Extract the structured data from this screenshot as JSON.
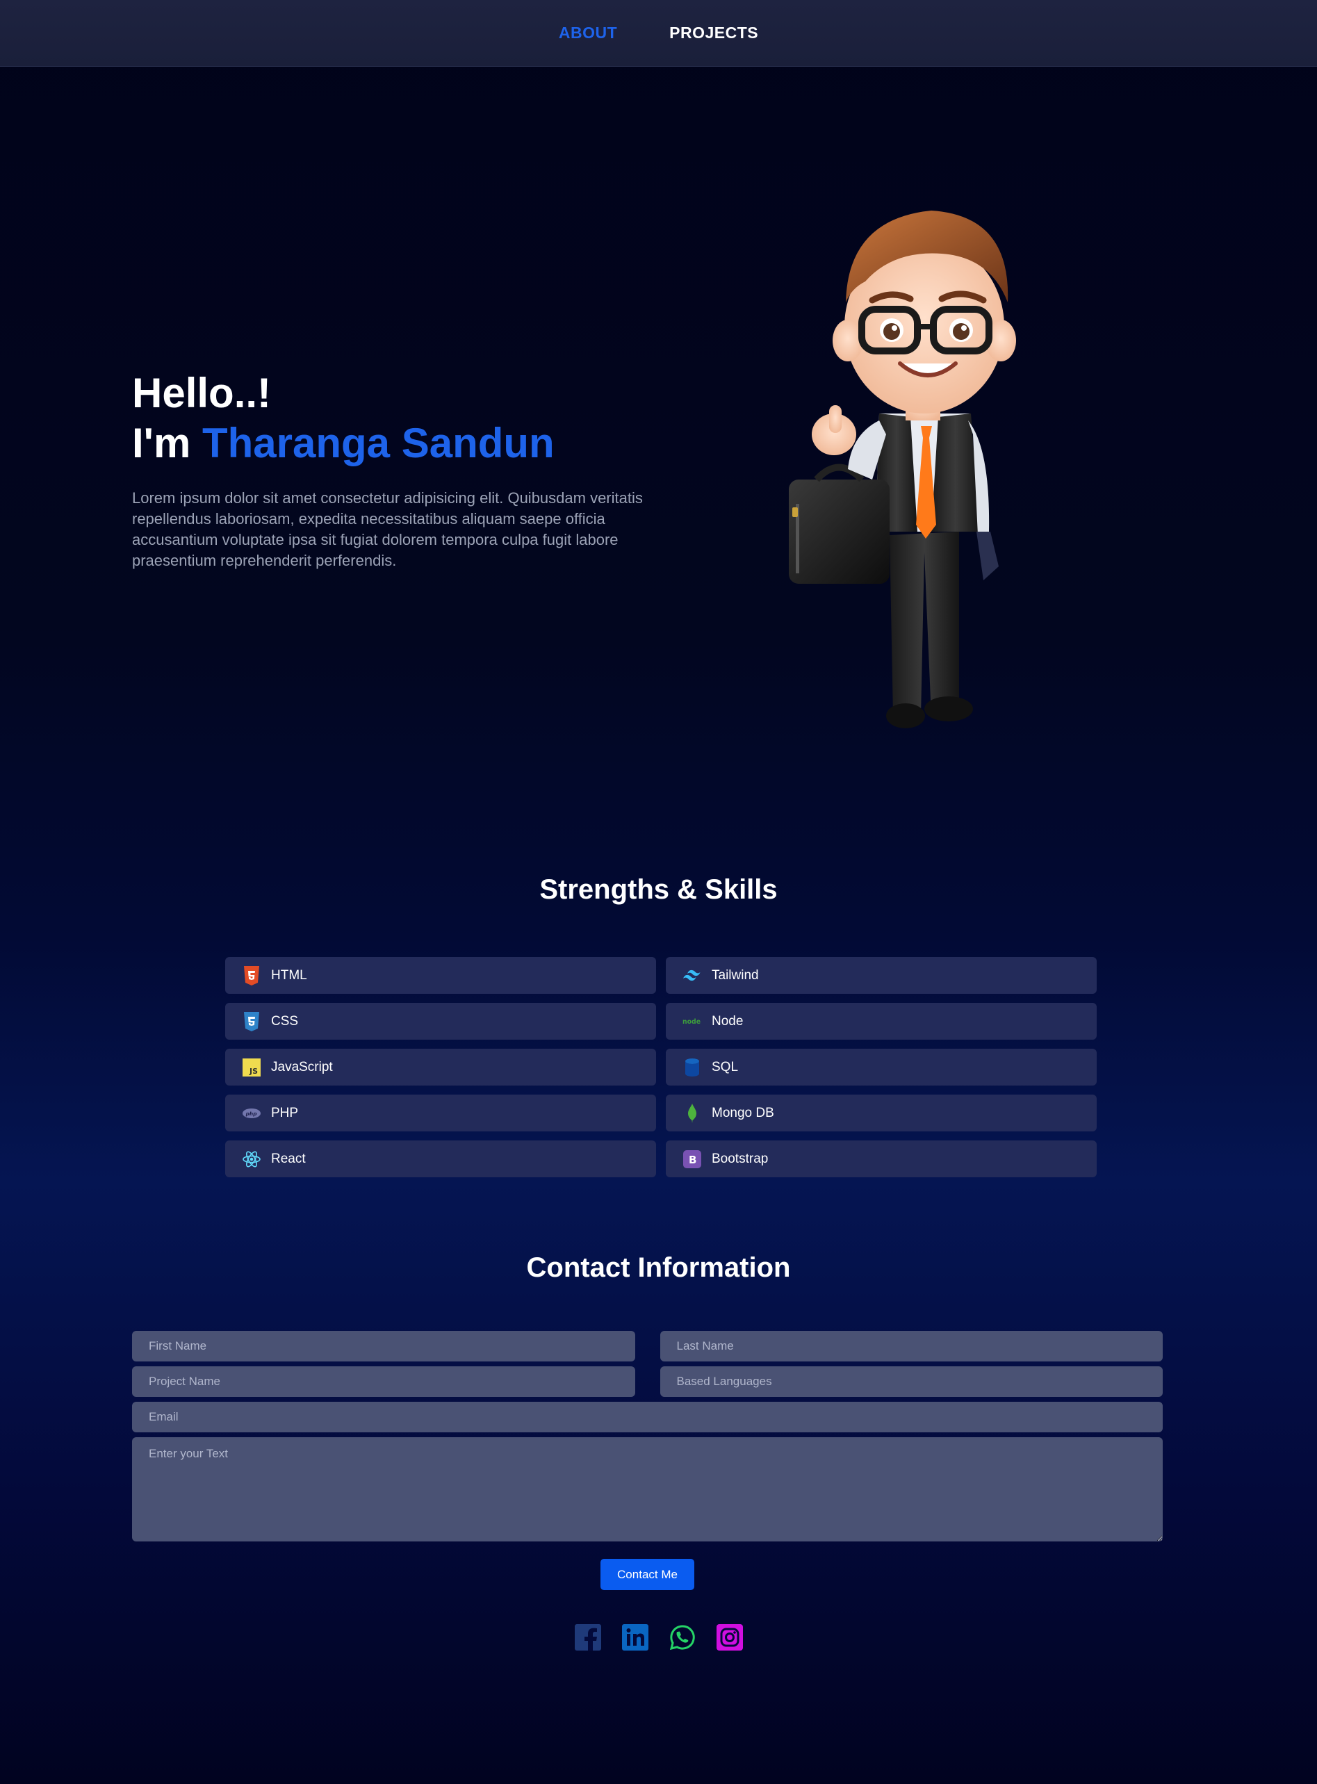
{
  "nav": {
    "items": [
      {
        "label": "ABOUT",
        "active": true
      },
      {
        "label": "PROJECTS",
        "active": false
      }
    ]
  },
  "hero": {
    "greeting": "Hello..!",
    "intro_prefix": "I'm",
    "name": "Tharanga Sandun",
    "description": "Lorem ipsum dolor sit amet consectetur adipisicing elit. Quibusdam veritatis repellendus laboriosam, expedita necessitatibus aliquam saepe officia accusantium voluptate ipsa sit fugiat dolorem tempora culpa fugit labore praesentium reprehenderit perferendis."
  },
  "skills": {
    "title": "Strengths & Skills",
    "items": [
      {
        "label": "HTML",
        "icon": "html5-icon"
      },
      {
        "label": "Tailwind",
        "icon": "tailwind-icon"
      },
      {
        "label": "CSS",
        "icon": "css3-icon"
      },
      {
        "label": "Node",
        "icon": "nodejs-icon"
      },
      {
        "label": "JavaScript",
        "icon": "javascript-icon"
      },
      {
        "label": "SQL",
        "icon": "database-icon"
      },
      {
        "label": "PHP",
        "icon": "php-icon"
      },
      {
        "label": "Mongo DB",
        "icon": "mongodb-icon"
      },
      {
        "label": "React",
        "icon": "react-icon"
      },
      {
        "label": "Bootstrap",
        "icon": "bootstrap-icon"
      }
    ]
  },
  "contact": {
    "title": "Contact Information",
    "first_name_placeholder": "First Name",
    "last_name_placeholder": "Last Name",
    "project_name_placeholder": "Project Name",
    "languages_placeholder": "Based Languages",
    "email_placeholder": "Email",
    "message_placeholder": "Enter your Text",
    "submit_label": "Contact Me"
  },
  "socials": [
    "facebook-icon",
    "linkedin-icon",
    "whatsapp-icon",
    "instagram-icon"
  ],
  "colors": {
    "accent": "#1e63ea",
    "nav_bg": "#1e2340",
    "skill_card_bg": "#232b5a",
    "input_bg": "#4a5274",
    "button_bg": "#0a5cf0",
    "facebook": "#1f3a7a",
    "linkedin": "#0a66c2",
    "whatsapp": "#25d366",
    "instagram": "#d10fe0"
  }
}
